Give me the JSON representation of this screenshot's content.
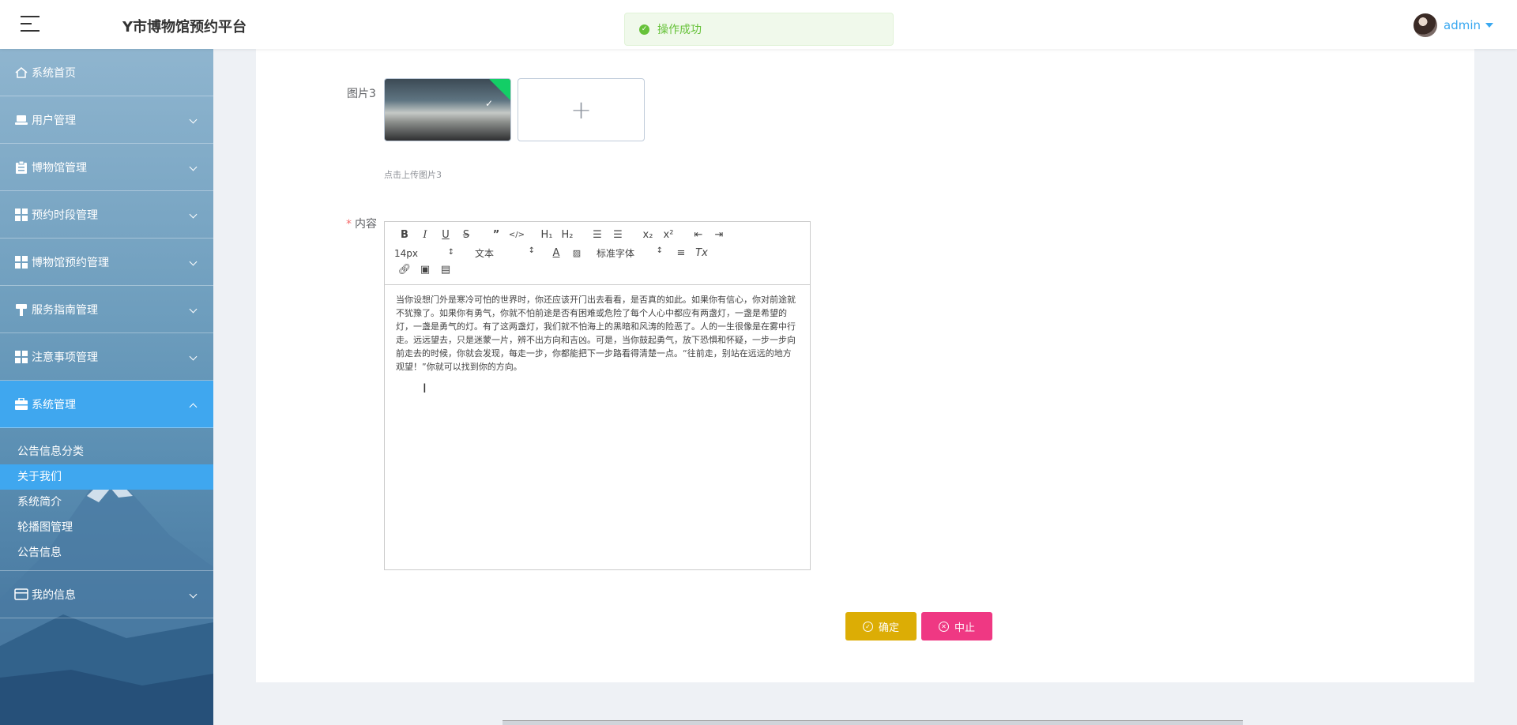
{
  "header": {
    "app_title": "Y市博物馆预约平台",
    "toast": "操作成功",
    "user_name": "admin"
  },
  "sidebar": {
    "items": [
      {
        "label": "系统首页",
        "icon": "home-icon"
      },
      {
        "label": "用户管理",
        "icon": "user-icon"
      },
      {
        "label": "博物馆管理",
        "icon": "clipboard-icon"
      },
      {
        "label": "预约时段管理",
        "icon": "grid-icon"
      },
      {
        "label": "博物馆预约管理",
        "icon": "grid-icon"
      },
      {
        "label": "服务指南管理",
        "icon": "hammer-icon"
      },
      {
        "label": "注意事项管理",
        "icon": "grid-icon"
      },
      {
        "label": "系统管理",
        "icon": "briefcase-icon"
      },
      {
        "label": "我的信息",
        "icon": "id-card-icon"
      }
    ],
    "submenu": [
      "公告信息分类",
      "关于我们",
      "系统简介",
      "轮播图管理",
      "公告信息"
    ],
    "active_submenu": "关于我们"
  },
  "form": {
    "image_label": "图片3",
    "upload_tip": "点击上传图片3",
    "content_label": "内容",
    "required_mark": "*",
    "toolbar": {
      "font_size": "14px",
      "text_style": "文本",
      "font_family": "标准字体"
    },
    "content_text": "当你设想门外是寒冷可怕的世界时，你还应该开门出去看看，是否真的如此。如果你有信心，你对前途就不犹豫了。如果你有勇气，你就不怕前途是否有困难或危险了每个人心中都应有两盏灯，一盏是希望的灯，一盏是勇气的灯。有了这两盏灯，我们就不怕海上的黑暗和风涛的险恶了。人的一生很像是在雾中行走。远远望去，只是迷蒙一片，辨不出方向和吉凶。可是，当你鼓起勇气，放下恐惧和怀疑，一步一步向前走去的时候，你就会发现，每走一步，你都能把下一步路看得清楚一点。“往前走，别站在远远的地方观望！”你就可以找到你的方向。",
    "confirm_label": "确定",
    "stop_label": "中止"
  }
}
